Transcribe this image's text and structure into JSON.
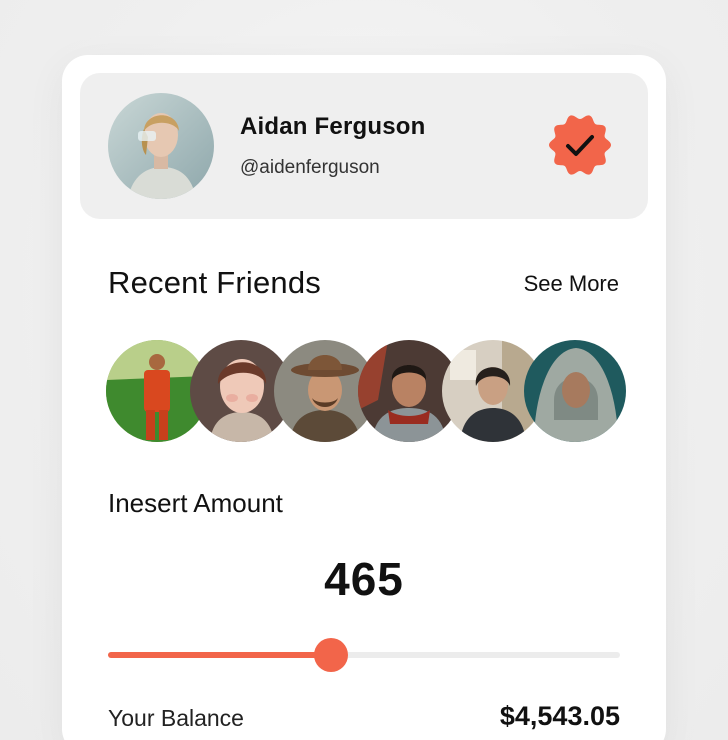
{
  "profile": {
    "name": "Aidan Ferguson",
    "handle": "@aidenferguson",
    "verified": true,
    "verified_icon": "verified-check-icon",
    "accent_color": "#f2654a"
  },
  "friends_section": {
    "title": "Recent Friends",
    "see_more_label": "See More",
    "friends": [
      {
        "avatar": "friend-avatar-1"
      },
      {
        "avatar": "friend-avatar-2"
      },
      {
        "avatar": "friend-avatar-3"
      },
      {
        "avatar": "friend-avatar-4"
      },
      {
        "avatar": "friend-avatar-5"
      },
      {
        "avatar": "friend-avatar-6"
      }
    ]
  },
  "amount": {
    "label": "Inesert Amount",
    "value": "465",
    "slider_fraction": 0.435
  },
  "balance": {
    "label": "Your Balance",
    "value": "$4,543.05"
  }
}
